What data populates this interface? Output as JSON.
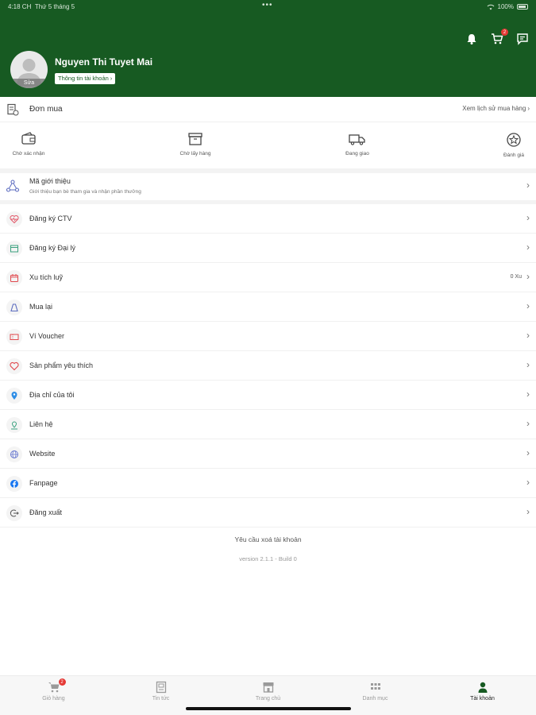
{
  "status_bar": {
    "time": "4:18 CH",
    "date": "Thứ 5 tháng 5",
    "battery": "100%"
  },
  "header": {
    "cart_badge": "2",
    "user_name": "Nguyen Thi Tuyet Mai",
    "avatar_edit_label": "Sửa",
    "account_info_label": "Thông tin tài khoản"
  },
  "orders": {
    "title": "Đơn mua",
    "history_link": "Xem lịch sử mua hàng",
    "statuses": [
      {
        "label": "Chờ xác nhận",
        "icon": "wallet-icon"
      },
      {
        "label": "Chờ lấy hàng",
        "icon": "box-icon"
      },
      {
        "label": "Đang giao",
        "icon": "truck-icon"
      },
      {
        "label": "Đánh giá",
        "icon": "star-icon"
      }
    ]
  },
  "referral": {
    "title": "Mã giới thiệu",
    "subtitle": "Giới thiệu bạn bè tham gia và nhận phần thưởng"
  },
  "menu": [
    {
      "label": "Đăng ký CTV",
      "icon": "heart-pulse-icon",
      "value": ""
    },
    {
      "label": "Đăng ký Đại lý",
      "icon": "store-icon",
      "value": ""
    },
    {
      "label": "Xu tích luỹ",
      "icon": "calendar-coin-icon",
      "value": "0 Xu"
    },
    {
      "label": "Mua lại",
      "icon": "bag-icon",
      "value": ""
    },
    {
      "label": "Ví Voucher",
      "icon": "voucher-icon",
      "value": ""
    },
    {
      "label": "Sản phẩm yêu thích",
      "icon": "heart-icon",
      "value": ""
    },
    {
      "label": "Địa chỉ của tôi",
      "icon": "location-pin-icon",
      "value": ""
    },
    {
      "label": "Liên hệ",
      "icon": "contact-pin-icon",
      "value": ""
    },
    {
      "label": "Website",
      "icon": "globe-icon",
      "value": ""
    },
    {
      "label": "Fanpage",
      "icon": "facebook-icon",
      "value": ""
    },
    {
      "label": "Đăng xuất",
      "icon": "logout-icon",
      "value": ""
    }
  ],
  "footer": {
    "delete_account": "Yêu cầu xoá tài khoản",
    "version": "version 2.1.1 - Build 0"
  },
  "bottom_nav": {
    "cart_badge": "2",
    "items": [
      {
        "label": "Giỏ hàng",
        "icon": "cart-icon"
      },
      {
        "label": "Tin tức",
        "icon": "news-icon"
      },
      {
        "label": "Trang chủ",
        "icon": "home-store-icon"
      },
      {
        "label": "Danh mục",
        "icon": "grid-icon"
      },
      {
        "label": "Tài khoản",
        "icon": "user-icon"
      }
    ]
  },
  "colors": {
    "brand_green": "#175a22",
    "badge_red": "#e53935"
  }
}
